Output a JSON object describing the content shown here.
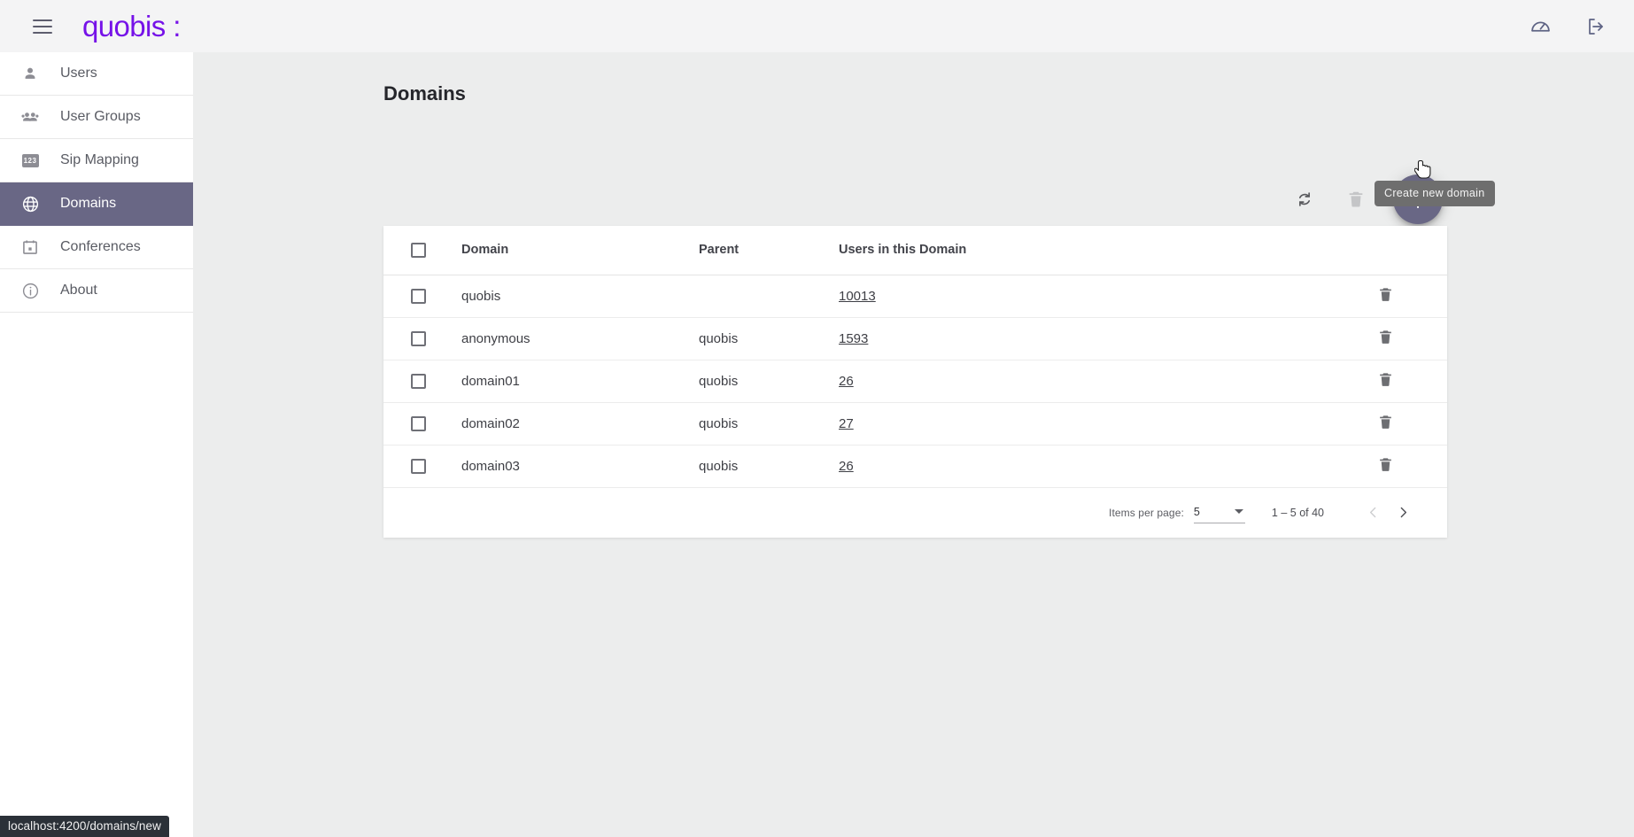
{
  "topbar": {
    "menu_icon": "hamburger-menu-icon",
    "brand": "quobis :",
    "brand_color": "#7612e8",
    "actions": [
      {
        "name": "dashboard-speedometer-icon",
        "label": "Dashboard"
      },
      {
        "name": "logout-icon",
        "label": "Logout"
      }
    ]
  },
  "sidebar": {
    "active_bg": "#696785",
    "items": [
      {
        "label": "Users",
        "icon": "person-icon",
        "active": false
      },
      {
        "label": "User Groups",
        "icon": "people-icon",
        "active": false
      },
      {
        "label": "Sip Mapping",
        "icon": "123-icon",
        "active": false
      },
      {
        "label": "Domains",
        "icon": "globe-icon",
        "active": true
      },
      {
        "label": "Conferences",
        "icon": "calendar-icon",
        "active": false
      },
      {
        "label": "About",
        "icon": "info-icon",
        "active": false
      }
    ]
  },
  "main": {
    "page_title": "Domains",
    "actions": {
      "refresh_label": "Refresh",
      "delete_label": "Delete",
      "create_label": "Create new domain",
      "create_tooltip": "Create new domain",
      "fab_color": "#696785"
    },
    "table": {
      "headers": [
        "Domain",
        "Parent",
        "Users in this Domain"
      ],
      "select_all_checked": false,
      "rows": [
        {
          "checked": false,
          "domain": "quobis",
          "parent": "",
          "users": "10013"
        },
        {
          "checked": false,
          "domain": "anonymous",
          "parent": "quobis",
          "users": "1593"
        },
        {
          "checked": false,
          "domain": "domain01",
          "parent": "quobis",
          "users": "26"
        },
        {
          "checked": false,
          "domain": "domain02",
          "parent": "quobis",
          "users": "27"
        },
        {
          "checked": false,
          "domain": "domain03",
          "parent": "quobis",
          "users": "26"
        }
      ]
    },
    "paginator": {
      "items_per_page_label": "Items per page:",
      "items_per_page_value": "5",
      "range_label": "1 – 5 of 40",
      "prev_enabled": false,
      "next_enabled": true
    }
  },
  "statusbar": {
    "url": "localhost:4200/domains/new"
  }
}
